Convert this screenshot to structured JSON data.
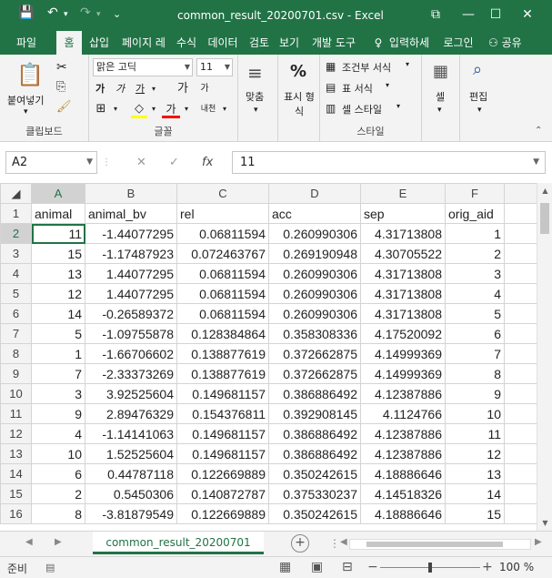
{
  "window": {
    "title": "common_result_20200701.csv - Excel",
    "quick_access": {
      "save": "💾",
      "undo": "↶",
      "redo": "↷",
      "customize": "⌄"
    },
    "buttons": {
      "ribbon_display": "⧉",
      "minimize": "—",
      "maximize": "☐",
      "close": "✕"
    }
  },
  "ribbon_tabs": {
    "file": "파일",
    "home": "홈",
    "insert": "삽입",
    "page_layout": "페이지 레",
    "formulas": "수식",
    "data": "데이터",
    "review": "검토",
    "view": "보기",
    "developer": "개발 도구",
    "tell_me": "입력하세",
    "sign_in": "로그인",
    "share": "공유"
  },
  "ribbon": {
    "clipboard": {
      "paste": "붙여넣기",
      "label": "클립보드"
    },
    "font": {
      "name": "맑은 고딕",
      "size": "11",
      "bold": "가",
      "italic": "가",
      "underline": "가",
      "grow": "가",
      "shrink": "가",
      "phonetic": "내천",
      "label": "글꼴"
    },
    "alignment": {
      "label": "맞춤"
    },
    "number": {
      "label": "표시 형식",
      "percent": "%"
    },
    "styles": {
      "conditional": "조건부 서식",
      "table": "표 서식",
      "cell_styles": "셀 스타일",
      "label": "스타일"
    },
    "cells": {
      "label": "셀"
    },
    "editing": {
      "label": "편집"
    }
  },
  "formula_bar": {
    "name_box": "A2",
    "cancel": "✕",
    "enter": "✓",
    "fx": "fx",
    "value": "11"
  },
  "sheet": {
    "columns": [
      "A",
      "B",
      "C",
      "D",
      "E",
      "F"
    ],
    "header_row": [
      "animal",
      "animal_bv",
      "rel",
      "acc",
      "sep",
      "orig_aid"
    ],
    "rows": [
      {
        "n": "2",
        "cells": [
          "11",
          "-1.44077295",
          "0.06811594",
          "0.260990306",
          "4.31713808",
          "1"
        ]
      },
      {
        "n": "3",
        "cells": [
          "15",
          "-1.17487923",
          "0.072463767",
          "0.269190948",
          "4.30705522",
          "2"
        ]
      },
      {
        "n": "4",
        "cells": [
          "13",
          "1.44077295",
          "0.06811594",
          "0.260990306",
          "4.31713808",
          "3"
        ]
      },
      {
        "n": "5",
        "cells": [
          "12",
          "1.44077295",
          "0.06811594",
          "0.260990306",
          "4.31713808",
          "4"
        ]
      },
      {
        "n": "6",
        "cells": [
          "14",
          "-0.26589372",
          "0.06811594",
          "0.260990306",
          "4.31713808",
          "5"
        ]
      },
      {
        "n": "7",
        "cells": [
          "5",
          "-1.09755878",
          "0.128384864",
          "0.358308336",
          "4.17520092",
          "6"
        ]
      },
      {
        "n": "8",
        "cells": [
          "1",
          "-1.66706602",
          "0.138877619",
          "0.372662875",
          "4.14999369",
          "7"
        ]
      },
      {
        "n": "9",
        "cells": [
          "7",
          "-2.33373269",
          "0.138877619",
          "0.372662875",
          "4.14999369",
          "8"
        ]
      },
      {
        "n": "10",
        "cells": [
          "3",
          "3.92525604",
          "0.149681157",
          "0.386886492",
          "4.12387886",
          "9"
        ]
      },
      {
        "n": "11",
        "cells": [
          "9",
          "2.89476329",
          "0.154376811",
          "0.392908145",
          "4.1124766",
          "10"
        ]
      },
      {
        "n": "12",
        "cells": [
          "4",
          "-1.14141063",
          "0.149681157",
          "0.386886492",
          "4.12387886",
          "11"
        ]
      },
      {
        "n": "13",
        "cells": [
          "10",
          "1.52525604",
          "0.149681157",
          "0.386886492",
          "4.12387886",
          "12"
        ]
      },
      {
        "n": "14",
        "cells": [
          "6",
          "0.44787118",
          "0.122669889",
          "0.350242615",
          "4.18886646",
          "13"
        ]
      },
      {
        "n": "15",
        "cells": [
          "2",
          "0.5450306",
          "0.140872787",
          "0.375330237",
          "4.14518326",
          "14"
        ]
      },
      {
        "n": "16",
        "cells": [
          "8",
          "-3.81879549",
          "0.122669889",
          "0.350242615",
          "4.18886646",
          "15"
        ]
      }
    ]
  },
  "sheet_tabs": {
    "active": "common_result_20200701",
    "add": "+"
  },
  "status_bar": {
    "ready": "준비",
    "zoom": "100 %",
    "zoom_out": "−",
    "zoom_in": "+"
  },
  "colors": {
    "accent": "#217346",
    "ribbon_bg": "#f3f3f3",
    "grid_line": "#d4d4d4"
  }
}
